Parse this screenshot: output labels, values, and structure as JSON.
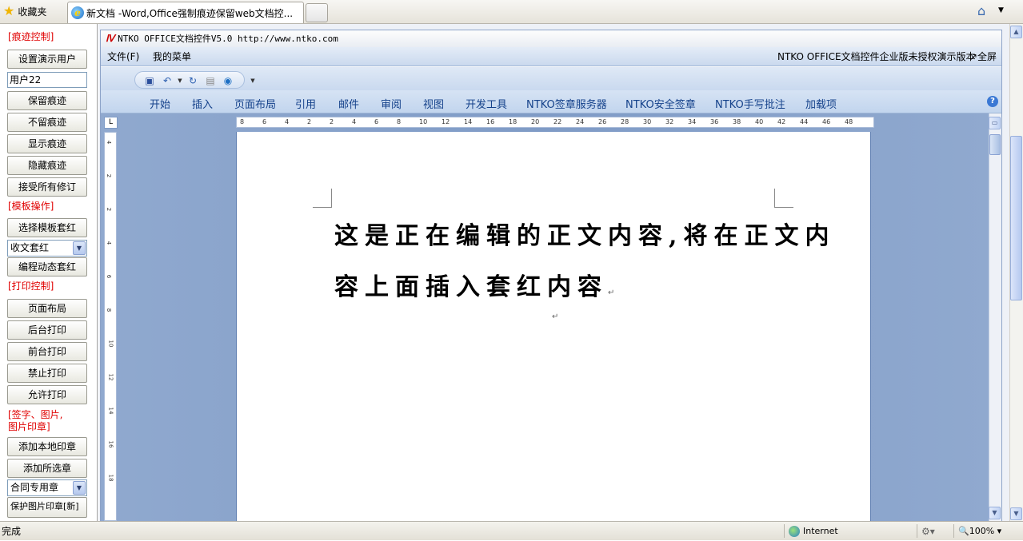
{
  "browser": {
    "favorites_label": "收藏夹",
    "tab_title": "新文档 -Word,Office强制痕迹保留web文档控..."
  },
  "sidebar": {
    "section_revision": "[痕迹控制]",
    "set_user_button": "设置演示用户",
    "user_input_value": "用户22",
    "keep_revisions": "保留痕迹",
    "no_revisions": "不留痕迹",
    "show_revisions": "显示痕迹",
    "hide_revisions": "隐藏痕迹",
    "accept_all": "接受所有修订",
    "section_template": "[模板操作]",
    "choose_template": "选择模板套红",
    "template_select_value": "收文套红",
    "dynamic_template": "编程动态套红",
    "section_print": "[打印控制]",
    "page_layout": "页面布局",
    "background_print": "后台打印",
    "foreground_print": "前台打印",
    "forbid_print": "禁止打印",
    "allow_print": "允许打印",
    "section_seal_line1": "[签字、图片,",
    "section_seal_line2": "图片印章]",
    "add_local_seal": "添加本地印章",
    "add_selected_seal": "添加所选章",
    "seal_select_value": "合同专用章",
    "protect_image_seal": "保护图片印章[新]"
  },
  "control": {
    "title_bar": "NTKO OFFICE文档控件V5.0 http://www.ntko.com",
    "menu_file": "文件(F)",
    "menu_my": "我的菜单",
    "menu_right_notice": "NTKO OFFICE文档控件企业版未授权演示版本",
    "menu_fullscreen": "↗全屏",
    "ribbon_tabs": [
      "开始",
      "插入",
      "页面布局",
      "引用",
      "邮件",
      "审阅",
      "视图",
      "开发工具",
      "NTKO签章服务器",
      "NTKO安全签章",
      "NTKO手写批注",
      "加载项"
    ]
  },
  "ruler": {
    "h_ticks": [
      "8",
      "6",
      "4",
      "2",
      "2",
      "4",
      "6",
      "8",
      "10",
      "12",
      "14",
      "16",
      "18",
      "20",
      "22",
      "24",
      "26",
      "28",
      "30",
      "32",
      "34",
      "36",
      "38",
      "40",
      "42",
      "44",
      "46",
      "48"
    ],
    "v_ticks": [
      "4",
      "2",
      "2",
      "4",
      "6",
      "8",
      "10",
      "12",
      "14",
      "16",
      "18"
    ]
  },
  "document": {
    "line1": "这是正在编辑的正文内容,将在正文内",
    "line2": "容上面插入套红内容"
  },
  "statusbar": {
    "status_text": "完成",
    "zone": "Internet",
    "zoom": "100%"
  }
}
